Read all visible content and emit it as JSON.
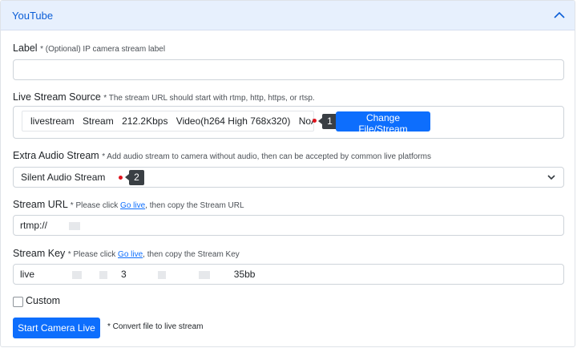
{
  "accordion": {
    "title": "YouTube",
    "icon": "chevron-up-icon"
  },
  "fields": {
    "label": {
      "title": "Label",
      "hint": "* (Optional) IP camera stream label",
      "value": ""
    },
    "source": {
      "title": "Live Stream Source",
      "hint": "* The stream URL should start with rtmp, http, https, or rtsp.",
      "value_parts": [
        "livestream",
        "Stream",
        "212.2Kbps",
        "Video(h264 High 768x320)",
        "NoAudio"
      ],
      "button": "Change File/Stream",
      "marker": "1"
    },
    "audio": {
      "title": "Extra Audio Stream",
      "hint": "* Add audio stream to camera without audio, then can be accepted by common live platforms",
      "value": "Silent Audio Stream",
      "marker": "2"
    },
    "stream_url": {
      "title": "Stream URL",
      "hint_pre": "* Please click ",
      "hint_link": "Go live",
      "hint_post": ", then copy the Stream URL",
      "value": "rtmp://"
    },
    "stream_key": {
      "title": "Stream Key",
      "hint_pre": "* Please click ",
      "hint_link": "Go live",
      "hint_post": ", then copy the Stream Key",
      "value_start": "live",
      "value_mid": "3",
      "value_end": "35bb"
    }
  },
  "custom": {
    "label": "Custom",
    "checked": false
  },
  "actions": {
    "start_button": "Start Camera Live",
    "hint": "* Convert file to live stream"
  },
  "colors": {
    "primary": "#0d6efd",
    "header_bg": "#e7f0fd",
    "marker": "#3a3f44",
    "dot": "#e0141e"
  }
}
